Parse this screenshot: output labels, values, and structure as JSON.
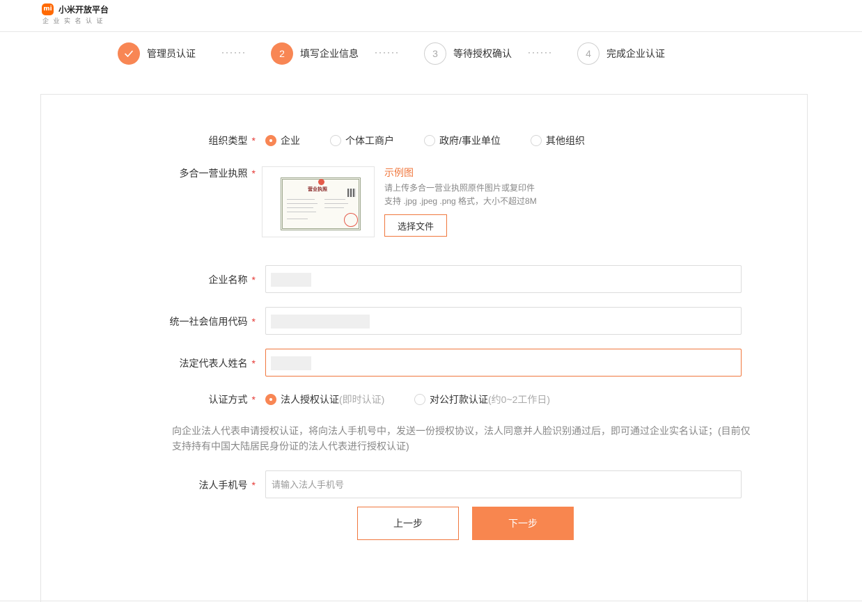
{
  "header": {
    "logo_text": "mi",
    "title": "小米开放平台",
    "subtitle": "企业实名认证"
  },
  "steps": [
    {
      "number": "✓",
      "label": "管理员认证",
      "state": "done"
    },
    {
      "number": "2",
      "label": "填写企业信息",
      "state": "active"
    },
    {
      "number": "3",
      "label": "等待授权确认",
      "state": "todo"
    },
    {
      "number": "4",
      "label": "完成企业认证",
      "state": "todo"
    }
  ],
  "step_separator": "······",
  "form": {
    "required_mark": "*",
    "org_type": {
      "label": "组织类型",
      "options": [
        "企业",
        "个体工商户",
        "政府/事业单位",
        "其他组织"
      ],
      "selected": "企业"
    },
    "license": {
      "label": "多合一营业执照",
      "cert_title": "营业执照",
      "example_link": "示例图",
      "hint_1": "请上传多合一营业执照原件图片或复印件",
      "hint_2": "支持 .jpg .jpeg .png 格式，大小不超过8M",
      "choose_button": "选择文件"
    },
    "company_name": {
      "label": "企业名称",
      "value": ""
    },
    "credit_code": {
      "label": "统一社会信用代码",
      "value": ""
    },
    "legal_rep_name": {
      "label": "法定代表人姓名",
      "value": ""
    },
    "auth_method": {
      "label": "认证方式",
      "options": [
        {
          "label": "法人授权认证",
          "note": "(即时认证)",
          "selected": true
        },
        {
          "label": "对公打款认证",
          "note": "(约0~2工作日)",
          "selected": false
        }
      ]
    },
    "description": "向企业法人代表申请授权认证，将向法人手机号中，发送一份授权协议，法人同意并人脸识别通过后，即可通过企业实名认证；(目前仅支持持有中国大陆居民身份证的法人代表进行授权认证)",
    "legal_phone": {
      "label": "法人手机号",
      "placeholder": "请输入法人手机号",
      "value": ""
    }
  },
  "buttons": {
    "prev": "上一步",
    "next": "下一步"
  },
  "colors": {
    "accent": "#f88654",
    "required": "#e53935",
    "link": "#f0773d"
  }
}
